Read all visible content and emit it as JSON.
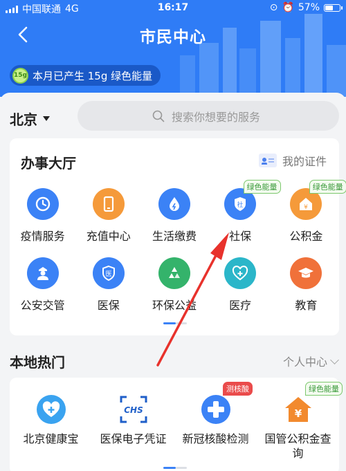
{
  "status_bar": {
    "carrier": "中国联通",
    "network": "4G",
    "time": "16:17",
    "battery": "57%",
    "battery_level": 0.57
  },
  "header": {
    "title": "市民中心",
    "back_icon": "chevron-left-icon",
    "energy_badge": "15g",
    "energy_text": "本月已产生 15g 绿色能量"
  },
  "location": {
    "city": "北京"
  },
  "search": {
    "placeholder": "搜索你想要的服务"
  },
  "office": {
    "title": "办事大厅",
    "my_cert": "我的证件",
    "items": [
      {
        "label": "疫情服务",
        "icon": "clock-icon",
        "color": "#3b82f6"
      },
      {
        "label": "充值中心",
        "icon": "phone-icon",
        "color": "#f59a3a"
      },
      {
        "label": "生活缴费",
        "icon": "water-drop-icon",
        "color": "#3b82f6"
      },
      {
        "label": "社保",
        "icon": "shield-icon",
        "color": "#3b82f6",
        "badge": "绿色能量"
      },
      {
        "label": "公积金",
        "icon": "house-icon",
        "color": "#f59a3a",
        "badge": "绿色能量"
      },
      {
        "label": "公安交管",
        "icon": "police-icon",
        "color": "#3b82f6"
      },
      {
        "label": "医保",
        "icon": "medical-shield-icon",
        "color": "#3b82f6"
      },
      {
        "label": "环保公益",
        "icon": "recycle-icon",
        "color": "#34b36b"
      },
      {
        "label": "医疗",
        "icon": "heart-plus-icon",
        "color": "#2bb6c9"
      },
      {
        "label": "教育",
        "icon": "graduation-cap-icon",
        "color": "#f0713a"
      }
    ]
  },
  "local_hot": {
    "title": "本地热门",
    "personal_center": "个人中心",
    "items": [
      {
        "label": "北京健康宝",
        "icon": "heart-plus-icon"
      },
      {
        "label": "医保电子凭证",
        "icon": "chs-scan-icon"
      },
      {
        "label": "新冠核酸检测",
        "icon": "medical-cross-icon",
        "badge": "测核酸"
      },
      {
        "label": "国管公积金查询",
        "icon": "house-yen-icon",
        "badge": "绿色能量"
      }
    ]
  }
}
